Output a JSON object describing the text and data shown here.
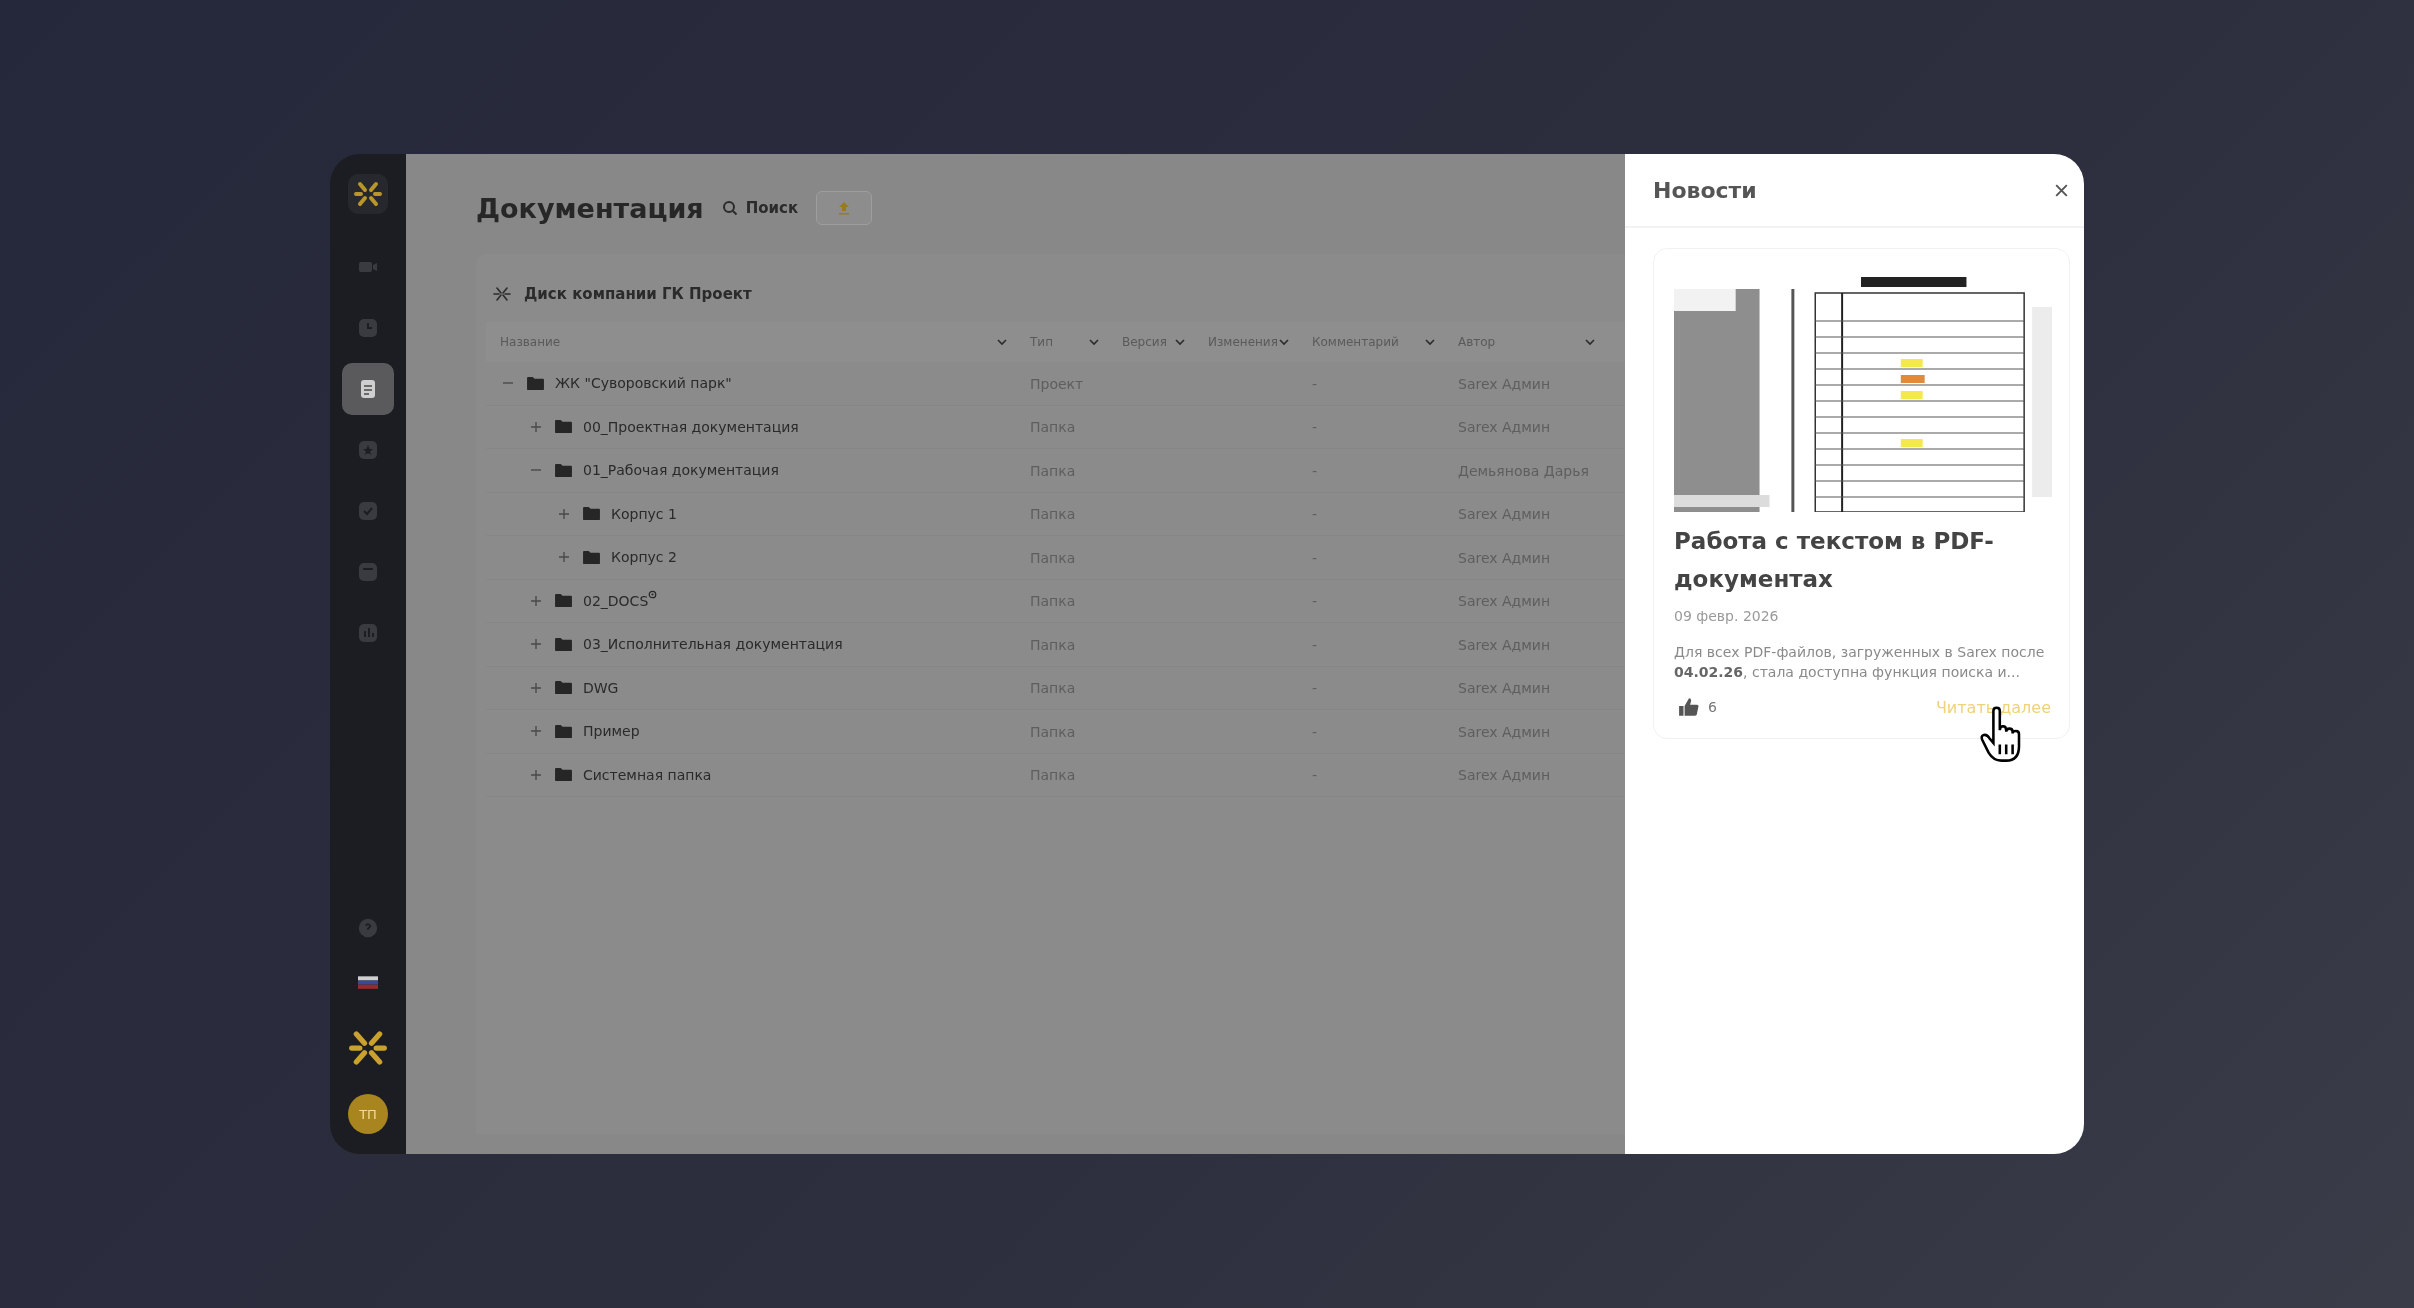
{
  "sidebar": {
    "items": [
      {
        "kind": "video",
        "selected": false
      },
      {
        "kind": "clock",
        "selected": false
      },
      {
        "kind": "document",
        "selected": true
      },
      {
        "kind": "star",
        "selected": false
      },
      {
        "kind": "check",
        "selected": false
      },
      {
        "kind": "calendar",
        "selected": false
      },
      {
        "kind": "chart",
        "selected": false
      }
    ],
    "avatar": "ТП"
  },
  "page": {
    "title": "Документация",
    "search_label": "Поиск"
  },
  "disk": {
    "name": "Диск компании ГК Проект"
  },
  "table": {
    "columns": [
      {
        "label": "Название"
      },
      {
        "label": "Тип"
      },
      {
        "label": "Версия"
      },
      {
        "label": "Изменения"
      },
      {
        "label": "Комментарий"
      },
      {
        "label": "Автор"
      }
    ],
    "rows": [
      {
        "name": "ЖК \"Суворовский парк\"",
        "type": "Проект",
        "comment": "-",
        "author": "Sarex Админ",
        "expanded": true,
        "children": [
          {
            "name": "00_Проектная документация",
            "type": "Папка",
            "comment": "-",
            "author": "Sarex Админ",
            "expanded": false
          },
          {
            "name": "01_Рабочая документация",
            "type": "Папка",
            "comment": "-",
            "author": "Демьянова Дарья",
            "expanded": true,
            "children": [
              {
                "name": "Корпус 1",
                "type": "Папка",
                "comment": "-",
                "author": "Sarex Админ",
                "expanded": false
              },
              {
                "name": "Корпус 2",
                "type": "Папка",
                "comment": "-",
                "author": "Sarex Админ",
                "expanded": false
              }
            ]
          },
          {
            "name": "02_DOCS",
            "type": "Папка",
            "comment": "-",
            "author": "Sarex Админ",
            "expanded": false,
            "shared": true
          },
          {
            "name": "03_Исполнительная документация",
            "type": "Папка",
            "comment": "-",
            "author": "Sarex Админ",
            "expanded": false
          },
          {
            "name": "DWG",
            "type": "Папка",
            "comment": "-",
            "author": "Sarex Админ",
            "expanded": false
          },
          {
            "name": "Пример",
            "type": "Папка",
            "comment": "-",
            "author": "Sarex Админ",
            "expanded": false
          },
          {
            "name": "Системная папка",
            "type": "Папка",
            "comment": "-",
            "author": "Sarex Админ",
            "expanded": false
          }
        ]
      }
    ]
  },
  "news": {
    "title": "Новости",
    "items": [
      {
        "title": "Работа с текстом в PDF-документах",
        "date": "09 февр. 2026",
        "excerpt": "Для всех PDF-файлов, загруженных в Sarex после **04.02.26**, стала доступна функция поиска и...",
        "likes": "6",
        "link": "Читать далее"
      }
    ]
  }
}
